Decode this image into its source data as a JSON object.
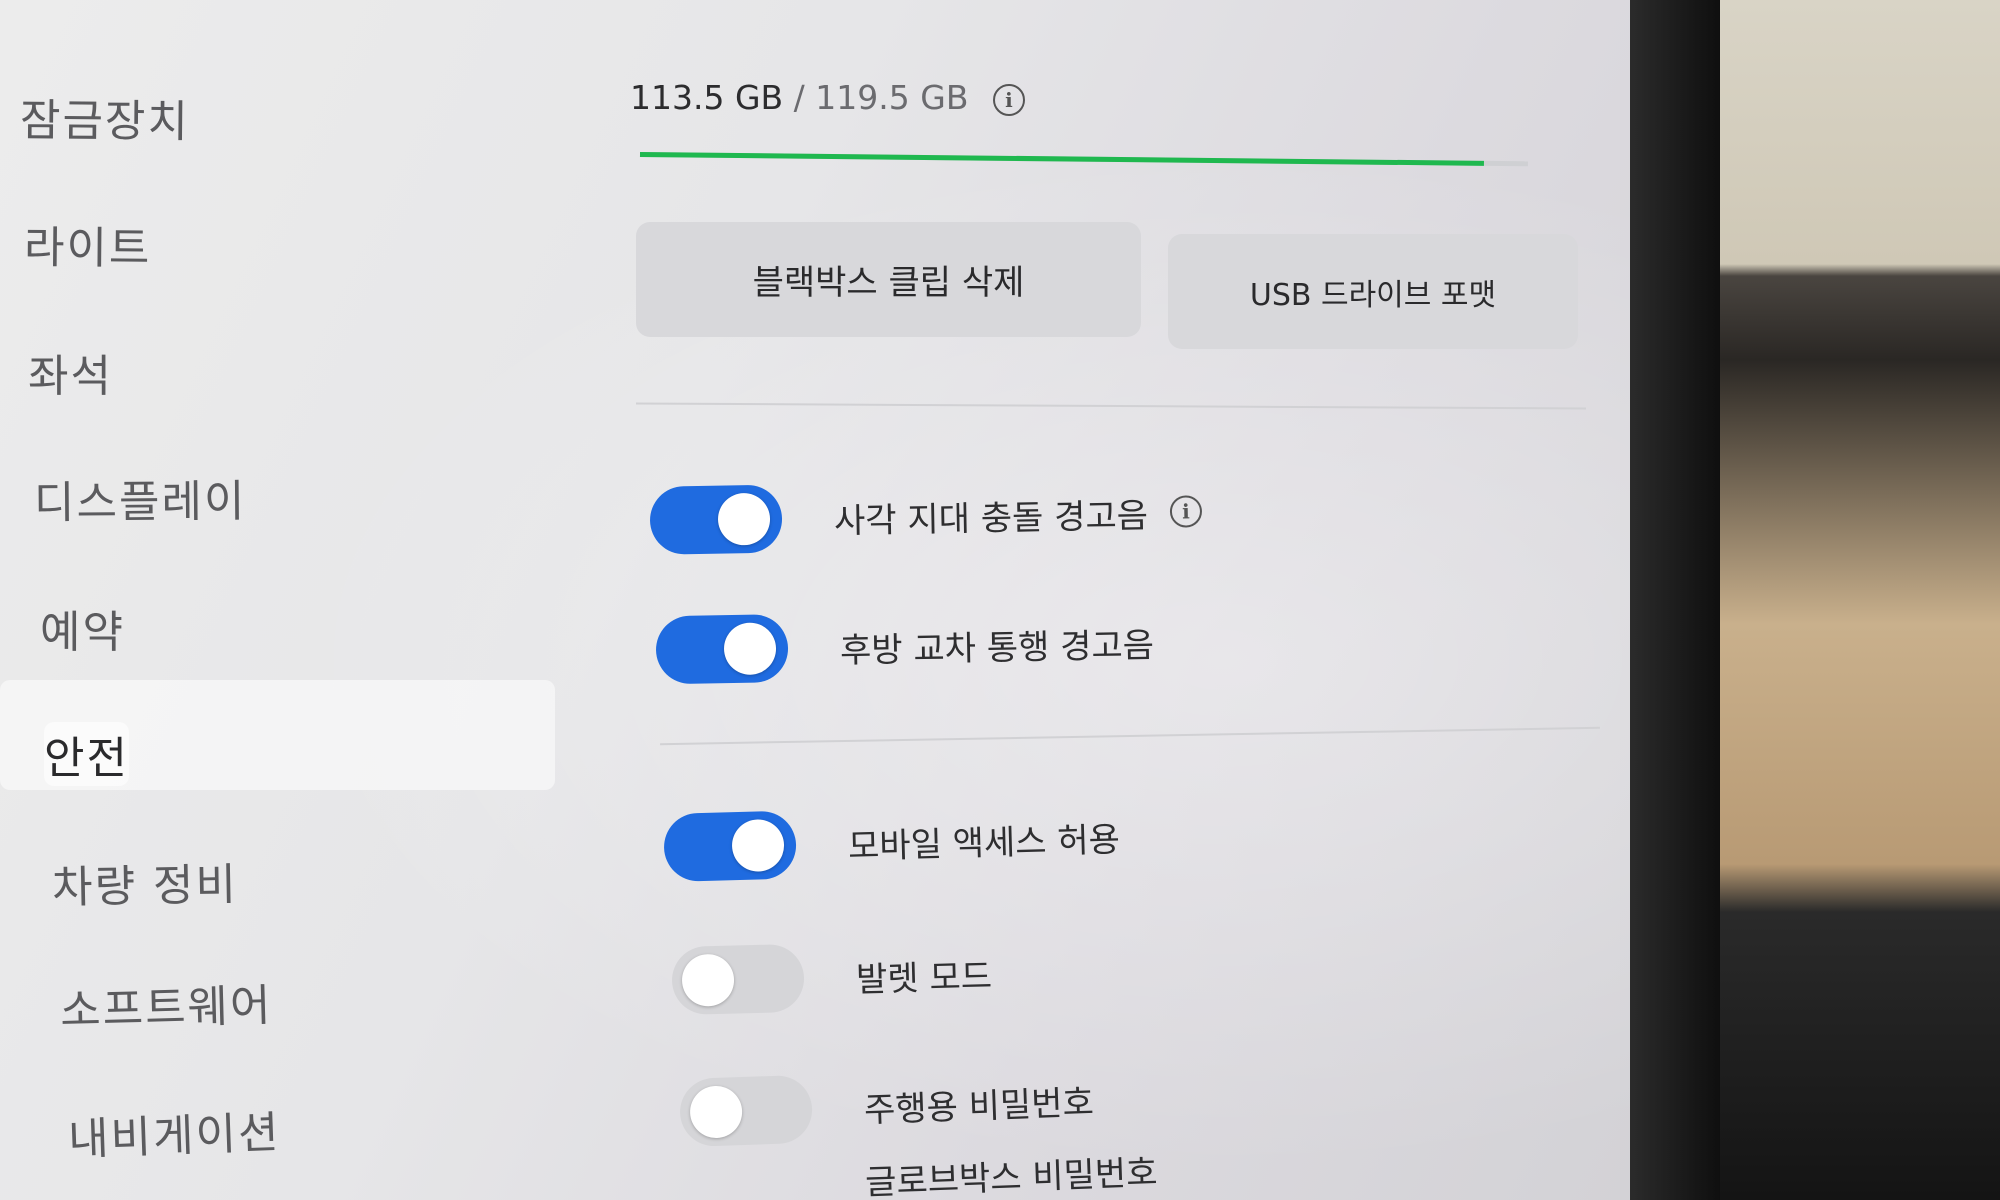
{
  "sidebar": {
    "items": [
      {
        "label": "잠금장치",
        "active": false
      },
      {
        "label": "라이트",
        "active": false
      },
      {
        "label": "좌석",
        "active": false
      },
      {
        "label": "디스플레이",
        "active": false
      },
      {
        "label": "예약",
        "active": false
      },
      {
        "label": "안전",
        "active": true
      },
      {
        "label": "차량 정비",
        "active": false
      },
      {
        "label": "소프트웨어",
        "active": false
      },
      {
        "label": "내비게이션",
        "active": false
      }
    ]
  },
  "storage": {
    "used": "113.5 GB",
    "separator": " / ",
    "total": "119.5 GB",
    "used_fraction": 0.95,
    "bar_color": "#1fb84f"
  },
  "buttons": {
    "delete_clips": "블랙박스 클립 삭제",
    "format_usb": "USB 드라이브 포맷"
  },
  "toggles": [
    {
      "label": "사각 지대 충돌 경고음",
      "on": true,
      "info": true
    },
    {
      "label": "후방 교차 통행 경고음",
      "on": true,
      "info": false
    },
    {
      "label": "모바일 액세스 허용",
      "on": true,
      "info": false
    },
    {
      "label": "발렛 모드",
      "on": false,
      "info": false
    },
    {
      "label": "주행용 비밀번호",
      "on": false,
      "info": false
    }
  ],
  "partial_row_label": "글로브박스 비밀번호",
  "colors": {
    "toggle_on": "#1f6be0",
    "toggle_off": "#d5d5d8",
    "progress": "#1fb84f"
  }
}
